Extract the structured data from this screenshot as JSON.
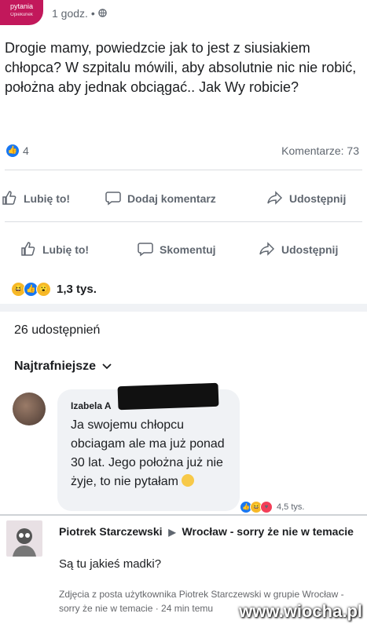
{
  "header": {
    "logo_text": "pytania",
    "logo_sub": "Opiekunek",
    "time": "1 godz. •",
    "privacy_icon": "globe-icon"
  },
  "post": {
    "text": "Drogie mamy, powiedzcie jak to jest z siusiakiem chłopca? W szpitalu mówili, aby absolutnie nic nie robić, położna aby jednak obciągać.. Jak Wy robicie?",
    "like_count": "4",
    "comments_count": "Komentarze: 73"
  },
  "actions1": {
    "like": "Lubię to!",
    "comment": "Dodaj komentarz",
    "share": "Udostępnij"
  },
  "actions2": {
    "like": "Lubię to!",
    "comment": "Skomentuj",
    "share": "Udostępnij"
  },
  "reactions": {
    "count": "1,3 tys.",
    "types": [
      "haha",
      "like",
      "wow"
    ]
  },
  "shares": "26 udostępnień",
  "sort_label": "Najtrafniejsze",
  "comment": {
    "author": "Izabela A",
    "text": "Ja swojemu chłopcu obciagam ale ma już ponad 30 lat. Jego położna już nie żyje, to nie pytałam",
    "reaction_count": "4,5 tys."
  },
  "reply": {
    "author": "Piotrek Starczewski",
    "group": "Wrocław - sorry że nie w temacie",
    "text": "Są tu jakieś madki?",
    "caption": "Zdjęcia z posta użytkownika Piotrek Starczewski w grupie Wrocław - sorry że nie w temacie · 24 min temu"
  },
  "watermark": "www.wiocha.pl",
  "colors": {
    "facebook_blue": "#1877f2",
    "text": "#1c1e21",
    "secondary_text": "#606770",
    "logo_pink": "#c2185b"
  }
}
